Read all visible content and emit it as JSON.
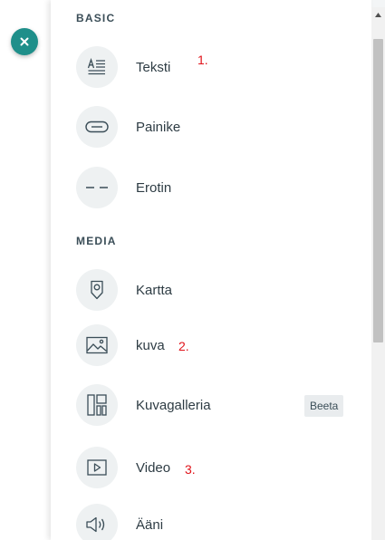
{
  "panel": {
    "sections": [
      {
        "heading": "BASIC",
        "items": [
          {
            "label": "Teksti",
            "icon": "text-align-icon"
          },
          {
            "label": "Painike",
            "icon": "button-icon"
          },
          {
            "label": "Erotin",
            "icon": "divider-icon"
          }
        ]
      },
      {
        "heading": "MEDIA",
        "items": [
          {
            "label": "Kartta",
            "icon": "map-pin-icon"
          },
          {
            "label": "kuva",
            "icon": "image-icon"
          },
          {
            "label": "Kuvagalleria",
            "icon": "gallery-icon",
            "badge": "Beeta"
          },
          {
            "label": "Video",
            "icon": "video-play-icon"
          },
          {
            "label": "Ääni",
            "icon": "speaker-icon"
          }
        ]
      }
    ]
  },
  "annotations": [
    "1.",
    "2.",
    "3."
  ],
  "colors": {
    "close_button": "#1f8f8a",
    "annotation": "#e0131a",
    "heading": "#3b4e58",
    "icon_bg": "#eef1f2"
  }
}
